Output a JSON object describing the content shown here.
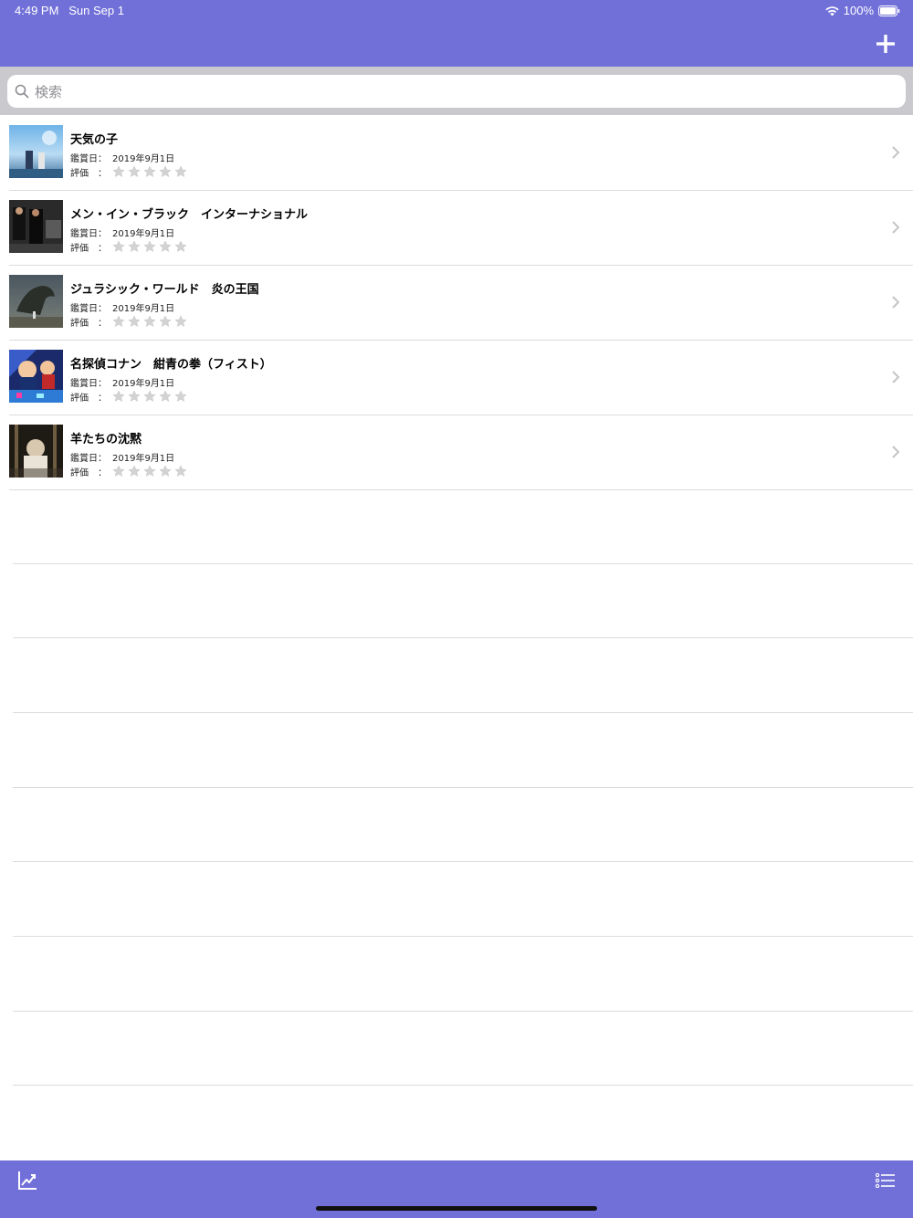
{
  "status": {
    "time": "4:49 PM",
    "date": "Sun Sep 1",
    "battery": "100%"
  },
  "nav": {
    "add_icon": "plus-icon"
  },
  "search": {
    "placeholder": "検索",
    "value": ""
  },
  "labels": {
    "date_key": "鑑賞日：",
    "rating_key": "評価　："
  },
  "colors": {
    "accent": "#7170d8",
    "search_bg": "#c9c9ce",
    "separator": "#dcdcdc"
  },
  "movies": [
    {
      "title": "天気の子",
      "date": "2019年9月1日",
      "rating": 0,
      "max_rating": 5
    },
    {
      "title": "メン・イン・ブラック　インターナショナル",
      "date": "2019年9月1日",
      "rating": 0,
      "max_rating": 5
    },
    {
      "title": "ジュラシック・ワールド　炎の王国",
      "date": "2019年9月1日",
      "rating": 0,
      "max_rating": 5
    },
    {
      "title": "名探偵コナン　紺青の拳（フィスト）",
      "date": "2019年9月1日",
      "rating": 0,
      "max_rating": 5
    },
    {
      "title": "羊たちの沈黙",
      "date": "2019年9月1日",
      "rating": 0,
      "max_rating": 5
    }
  ],
  "toolbar": {
    "left_icon": "chart-line-icon",
    "right_icon": "list-icon"
  }
}
